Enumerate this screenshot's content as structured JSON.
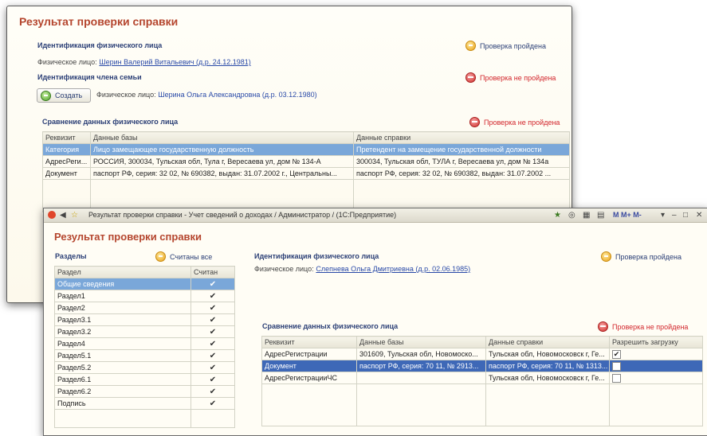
{
  "w1": {
    "title": "Результат проверки справки",
    "person_section": "Идентификация физического лица",
    "person_label": "Физическое лицо:",
    "person_value": "Шерин Валерий Витальевич (д.р. 24.12.1981)",
    "person_status": "Проверка пройдена",
    "family_section": "Идентификация члена семьи",
    "family_status": "Проверка не пройдена",
    "create_button": "Создать",
    "family_label": "Физическое лицо:",
    "family_value": "Шерина Ольга Александровна (д.р. 03.12.1980)",
    "compare_title": "Сравнение данных физического лица",
    "compare_status": "Проверка не пройдена",
    "table": {
      "headers": [
        "Реквизит",
        "Данные базы",
        "Данные справки"
      ],
      "rows": [
        [
          "Категория",
          "Лицо замещающее государственную должность",
          "Претендент на замещение государственной должности"
        ],
        [
          "АдресРеги...",
          "РОССИЯ, 300034, Тульская обл, Тула г, Вересаева ул, дом № 134-А",
          "300034, Тульская обл, ТУЛА г, Вересаева ул, дом № 134а"
        ],
        [
          "Документ",
          "паспорт РФ, серия: 32 02, № 690382, выдан: 31.07.2002 г., Центральны...",
          "паспорт РФ, серия: 32 02, № 690382, выдан: 31.07.2002 ..."
        ]
      ]
    }
  },
  "w2": {
    "window_title": "Результат проверки справки - Учет сведений о доходах / Администратор /  (1С:Предприятие)",
    "toolbar_right": "M  M+  M-",
    "title": "Результат проверки справки",
    "sections_label": "Разделы",
    "sections_status": "Считаны все",
    "sections_headers": [
      "Раздел",
      "Считан"
    ],
    "sections": [
      {
        "name": "Общие сведения",
        "read": "✔"
      },
      {
        "name": "Раздел1",
        "read": "✔"
      },
      {
        "name": "Раздел2",
        "read": "✔"
      },
      {
        "name": "Раздел3.1",
        "read": "✔"
      },
      {
        "name": "Раздел3.2",
        "read": "✔"
      },
      {
        "name": "Раздел4",
        "read": "✔"
      },
      {
        "name": "Раздел5.1",
        "read": "✔"
      },
      {
        "name": "Раздел5.2",
        "read": "✔"
      },
      {
        "name": "Раздел6.1",
        "read": "✔"
      },
      {
        "name": "Раздел6.2",
        "read": "✔"
      },
      {
        "name": "Подпись",
        "read": "✔"
      }
    ],
    "person_section": "Идентификация физического лица",
    "person_label": "Физическое лицо:",
    "person_value": "Слепнева Ольга Дмитриевна (д.р. 02.06.1985)",
    "person_status": "Проверка пройдена",
    "compare_title": "Сравнение данных физического лица",
    "compare_status": "Проверка не пройдена",
    "table": {
      "headers": [
        "Реквизит",
        "Данные базы",
        "Данные справки",
        "Разрешить загрузку"
      ],
      "rows": [
        [
          "АдресРегистрации",
          "301609, Тульская обл, Новомоско...",
          "Тульская обл, Новомосковск г, Ге...",
          "✔"
        ],
        [
          "Документ",
          "паспорт РФ, серия: 70 11, № 2913...",
          "паспорт РФ, серия: 70 11, № 1313...",
          ""
        ],
        [
          "АдресРегистрацииЧС",
          "",
          "Тульская обл, Новомосковск г, Ге...",
          ""
        ]
      ]
    }
  }
}
